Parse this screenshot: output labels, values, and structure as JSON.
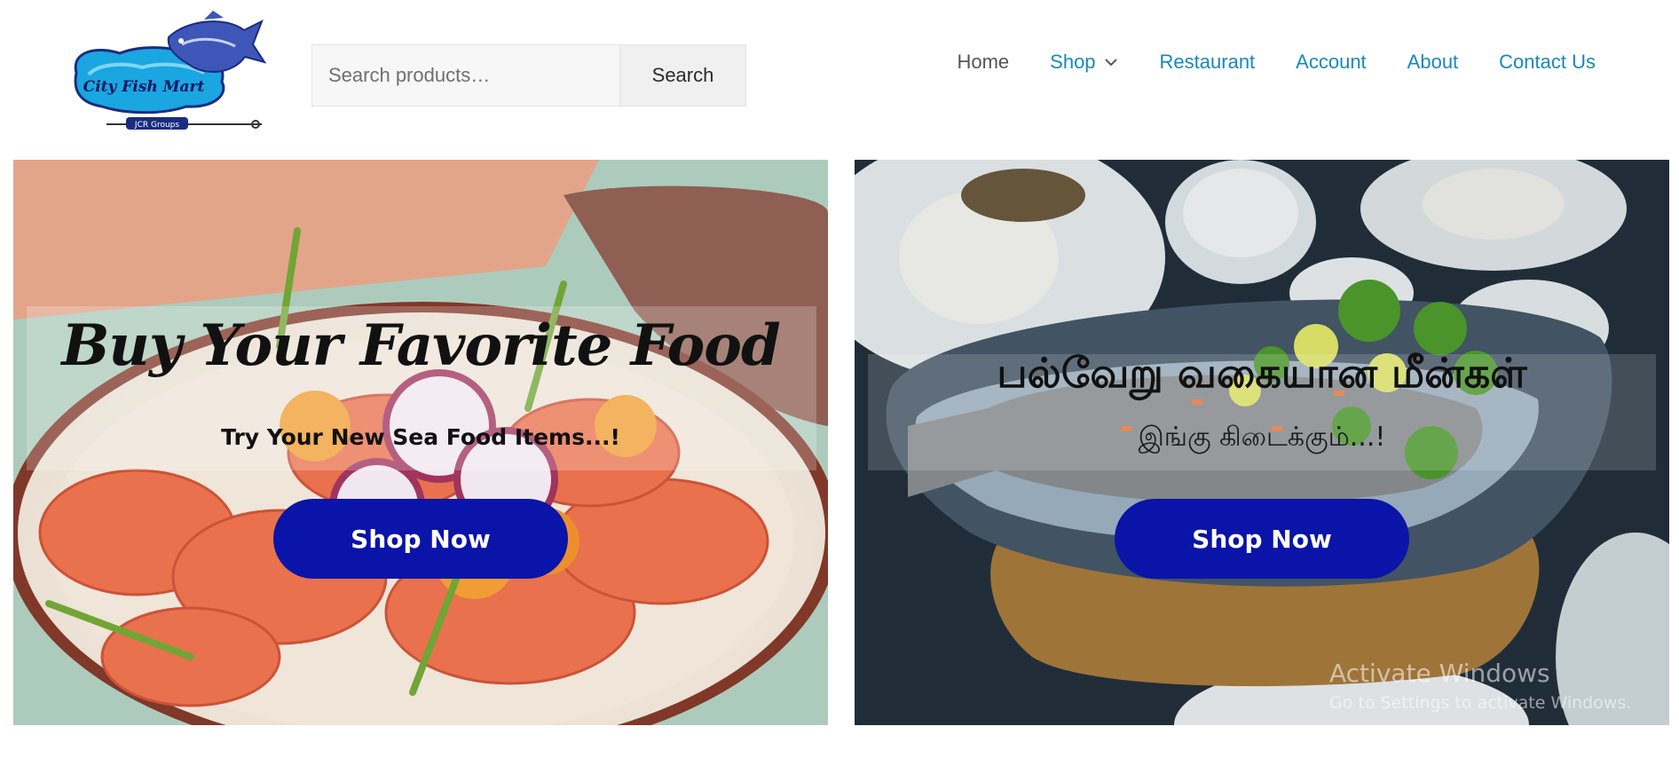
{
  "header": {
    "logo": {
      "title": "City Fish Mart",
      "tagline": "JCR Groups"
    },
    "search": {
      "placeholder": "Search products…",
      "button_label": "Search"
    },
    "nav": [
      {
        "label": "Home",
        "active": false
      },
      {
        "label": "Shop",
        "has_dropdown": true
      },
      {
        "label": "Restaurant"
      },
      {
        "label": "Account"
      },
      {
        "label": "About"
      },
      {
        "label": "Contact Us"
      }
    ]
  },
  "banners": {
    "left": {
      "title": "Buy Your Favorite Food",
      "subtitle": "Try Your New Sea Food Items...!",
      "button_label": "Shop Now"
    },
    "right": {
      "title": "பல்வேறு வகையான மீன்கள்",
      "subtitle": "இங்கு கிடைக்கும்...!",
      "button_label": "Shop Now"
    }
  },
  "watermark": {
    "title": "Activate Windows",
    "subtitle": "Go to Settings to activate Windows."
  },
  "colors": {
    "link": "#1788bd",
    "home_link": "#555555",
    "shop_button": "#0a14a8"
  }
}
